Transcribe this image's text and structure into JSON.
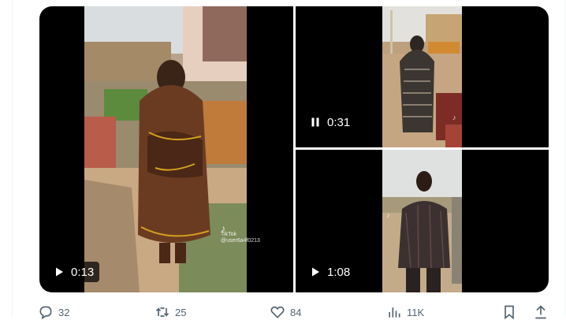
{
  "media": {
    "videos": [
      {
        "duration": "0:13",
        "state_icon": "play-icon"
      },
      {
        "duration": "0:31",
        "state_icon": "pause-icon"
      },
      {
        "duration": "1:08",
        "state_icon": "play-icon"
      }
    ],
    "watermark": {
      "brand": "TikTok",
      "handle": "@user6a4f0213"
    }
  },
  "actions": {
    "reply_count": "32",
    "retweet_count": "25",
    "like_count": "84",
    "views_count": "11K"
  },
  "colors": {
    "action_gray": "#536471",
    "divider": "#eff3f4"
  }
}
